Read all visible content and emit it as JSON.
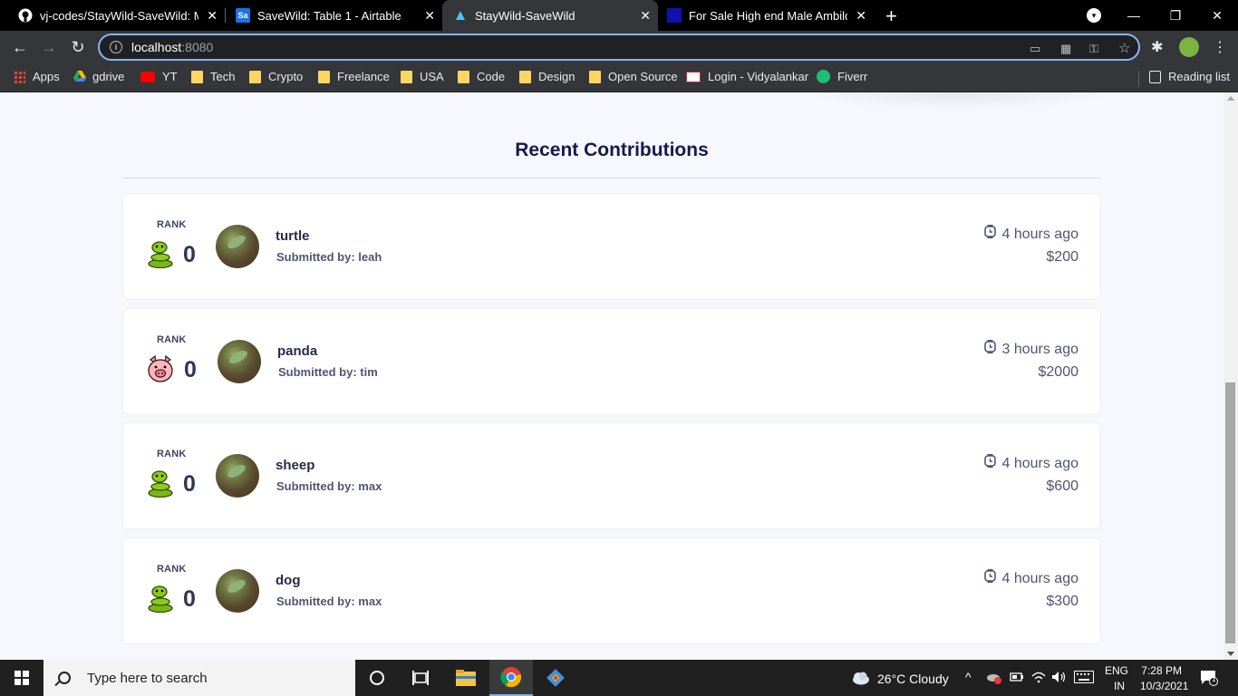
{
  "browser": {
    "tabs": [
      {
        "title": "vj-codes/StayWild-SaveWild: My",
        "favicon": "github-icon",
        "active": false
      },
      {
        "title": "SaveWild: Table 1 - Airtable",
        "favicon": "Sa",
        "active": false
      },
      {
        "title": "StayWild-SaveWild",
        "favicon": "staywild-icon",
        "active": true
      },
      {
        "title": "For Sale High end Male Ambilob",
        "favicon": "blue-square-icon",
        "active": false
      }
    ],
    "url_host": "localhost",
    "url_port": ":8080",
    "bookmarks": [
      {
        "label": "Apps",
        "icon": "apps-grid-icon"
      },
      {
        "label": "gdrive",
        "icon": "google-drive-icon"
      },
      {
        "label": "YT",
        "icon": "youtube-icon"
      },
      {
        "label": "Tech",
        "icon": "folder-icon"
      },
      {
        "label": "Crypto",
        "icon": "folder-icon"
      },
      {
        "label": "Freelance",
        "icon": "folder-icon"
      },
      {
        "label": "USA",
        "icon": "folder-icon"
      },
      {
        "label": "Code",
        "icon": "folder-icon"
      },
      {
        "label": "Design",
        "icon": "folder-icon"
      },
      {
        "label": "Open Source",
        "icon": "folder-icon"
      },
      {
        "label": "Login - Vidyalankar",
        "icon": "vidyalankar-icon"
      },
      {
        "label": "Fiverr",
        "icon": "fiverr-icon"
      }
    ],
    "reading_list": "Reading list"
  },
  "page": {
    "section_title": "Recent Contributions",
    "rank_label": "RANK",
    "submitted_prefix": "Submitted by:",
    "contributions": [
      {
        "rank": "0",
        "emoji": "snake-emoji",
        "animal": "turtle",
        "submitter": "leah",
        "submitted_text": "Submitted by: leah",
        "time": "4 hours ago",
        "amount": "$200"
      },
      {
        "rank": "0",
        "emoji": "pig-face-emoji",
        "animal": "panda",
        "submitter": "tim",
        "submitted_text": "Submitted by: tim",
        "time": "3 hours ago",
        "amount": "$2000"
      },
      {
        "rank": "0",
        "emoji": "snake-emoji",
        "animal": "sheep",
        "submitter": "max",
        "submitted_text": "Submitted by: max",
        "time": "4 hours ago",
        "amount": "$600"
      },
      {
        "rank": "0",
        "emoji": "snake-emoji",
        "animal": "dog",
        "submitter": "max",
        "submitted_text": "Submitted by: max",
        "time": "4 hours ago",
        "amount": "$300"
      }
    ]
  },
  "taskbar": {
    "search_placeholder": "Type here to search",
    "weather": "26°C  Cloudy",
    "language": "ENG",
    "region": "IN",
    "time": "7:28 PM",
    "date": "10/3/2021",
    "notification_count": "1"
  }
}
